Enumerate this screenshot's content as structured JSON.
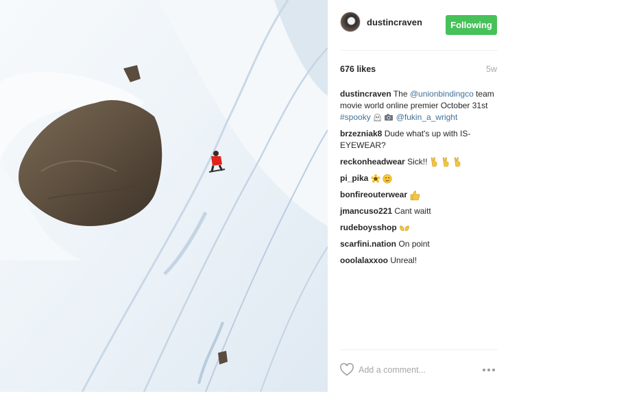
{
  "post": {
    "image_alt": "",
    "header": {
      "username": "dustincraven",
      "follow_label": "Following"
    },
    "likes": "676 likes",
    "age": "5w",
    "caption": {
      "user": "dustincraven",
      "text_1": "The ",
      "mention_1": "@unionbindingco",
      "text_2": " team movie world online premier October 31st ",
      "hashtag": "#spooky",
      "text_3": " ",
      "mention_2": "@fukin_a_wright"
    },
    "comments": [
      {
        "user": "brzezniak8",
        "text": "Dude what's up with IS-EYEWEAR?"
      },
      {
        "user": "reckonheadwear",
        "text": "Sick!!"
      },
      {
        "user": "pi_pika",
        "text": ""
      },
      {
        "user": "bonfireouterwear",
        "text": ""
      },
      {
        "user": "jmancuso221",
        "text": "Cant waitt"
      },
      {
        "user": "rudeboysshop",
        "text": ""
      },
      {
        "user": "scarfini.nation",
        "text": "On point"
      },
      {
        "user": "ooolalaxxoo",
        "text": "Unreal!"
      }
    ],
    "add_comment_placeholder": "Add a comment...",
    "icons": {
      "like": "heart-icon",
      "more": "more-options-icon",
      "emoji": [
        "ghost-emoji-icon",
        "camera-emoji-icon",
        "victory-hand-icon",
        "sunflower-emoji-icon",
        "relieved-face-icon",
        "thumbs-up-icon",
        "raised-hands-icon"
      ]
    },
    "colors": {
      "follow_button": "#47c159",
      "link": "#3f729b",
      "muted": "#a5a7aa"
    }
  }
}
